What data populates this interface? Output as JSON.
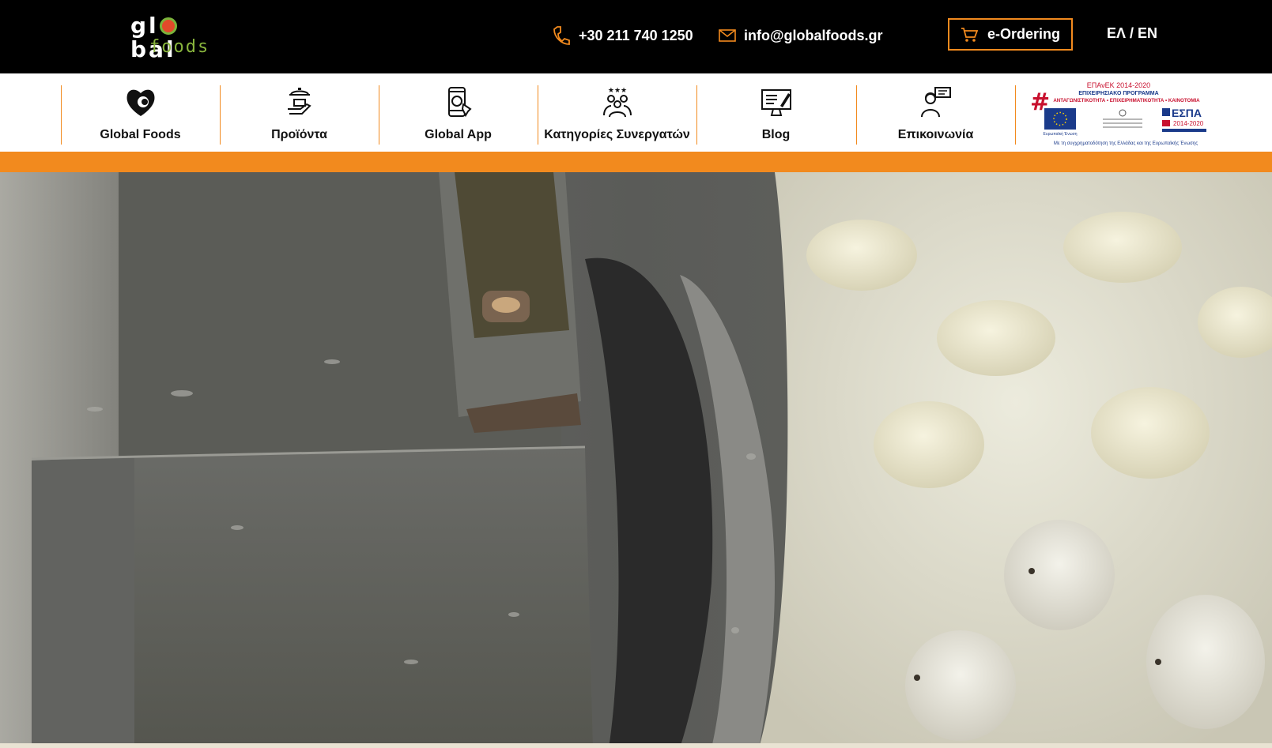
{
  "header": {
    "logo": {
      "line1_a": "gl",
      "line1_b": "bal",
      "line2": "foods"
    },
    "phone": "+30 211 740 1250",
    "email": "info@globalfoods.gr",
    "eordering_label": "e-Ordering",
    "language": "ΕΛ / EN"
  },
  "nav": {
    "items": [
      {
        "label": "Global Foods",
        "icon": "global-foods-logo-icon"
      },
      {
        "label": "Προϊόντα",
        "icon": "waiter-tray-icon"
      },
      {
        "label": "Global App",
        "icon": "mobile-app-icon"
      },
      {
        "label": "Κατηγορίες Συνεργατών",
        "icon": "partners-group-icon"
      },
      {
        "label": "Blog",
        "icon": "monitor-blog-icon"
      },
      {
        "label": "Επικοινωνία",
        "icon": "support-agent-icon"
      }
    ]
  },
  "espa": {
    "top": "ΕΠΑνΕΚ 2014-2020",
    "line2": "ΕΠΙΧΕΙΡΗΣΙΑΚΟ ΠΡΟΓΡΑΜΜΑ",
    "line3": "ΑΝΤΑΓΩΝΙΣΤΙΚΟΤΗΤΑ • ΕΠΙΧΕΙΡΗΜΑΤΙΚΟΤΗΤΑ • ΚΑΙΝΟΤΟΜΙΑ",
    "eu_label": "Ευρωπαϊκή Ένωση",
    "espa_label": "ΕΣΠΑ",
    "espa_years": "2014-2020",
    "footer": "Με τη συγχρηματοδότηση της Ελλάδας και της Ευρωπαϊκής Ένωσης"
  },
  "colors": {
    "accent": "#f28a1e",
    "topbar": "#000000",
    "logo_green": "#89b53d",
    "logo_red": "#e24a2a"
  }
}
